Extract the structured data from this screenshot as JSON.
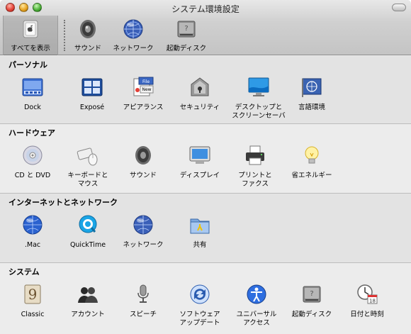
{
  "window": {
    "title": "システム環境設定"
  },
  "toolbar": {
    "show_all": "すべてを表示",
    "items": [
      "サウンド",
      "ネットワーク",
      "起動ディスク"
    ]
  },
  "sections": [
    {
      "heading": "パーソナル",
      "items": [
        "Dock",
        "Exposé",
        "アピアランス",
        "セキュリティ",
        "デスクトップと\nスクリーンセーバ",
        "言語環境"
      ]
    },
    {
      "heading": "ハードウェア",
      "items": [
        "CD と DVD",
        "キーボードと\nマウス",
        "サウンド",
        "ディスプレイ",
        "プリントと\nファクス",
        "省エネルギー"
      ]
    },
    {
      "heading": "インターネットとネットワーク",
      "items": [
        ".Mac",
        "QuickTime",
        "ネットワーク",
        "共有"
      ]
    },
    {
      "heading": "システム",
      "items": [
        "Classic",
        "アカウント",
        "スピーチ",
        "ソフトウェア\nアップデート",
        "ユニバーサル\nアクセス",
        "起動ディスク",
        "日付と時刻"
      ]
    }
  ],
  "icons": {
    "toolbar": [
      "apple-switch-icon",
      "speaker-icon",
      "network-globe-icon",
      "hard-disk-icon"
    ],
    "personal": [
      "dock-icon",
      "expose-icon",
      "appearance-icon",
      "security-icon",
      "desktop-screensaver-icon",
      "language-flag-icon"
    ],
    "hardware": [
      "cd-dvd-icon",
      "keyboard-mouse-icon",
      "speaker-icon",
      "display-icon",
      "printer-icon",
      "light-bulb-icon"
    ],
    "internet": [
      "dotmac-globe-icon",
      "quicktime-icon",
      "network-globe-icon",
      "sharing-folder-icon"
    ],
    "system": [
      "classic-icon",
      "accounts-icon",
      "speech-microphone-icon",
      "software-update-icon",
      "universal-access-icon",
      "hard-disk-icon",
      "clock-calendar-icon"
    ]
  }
}
